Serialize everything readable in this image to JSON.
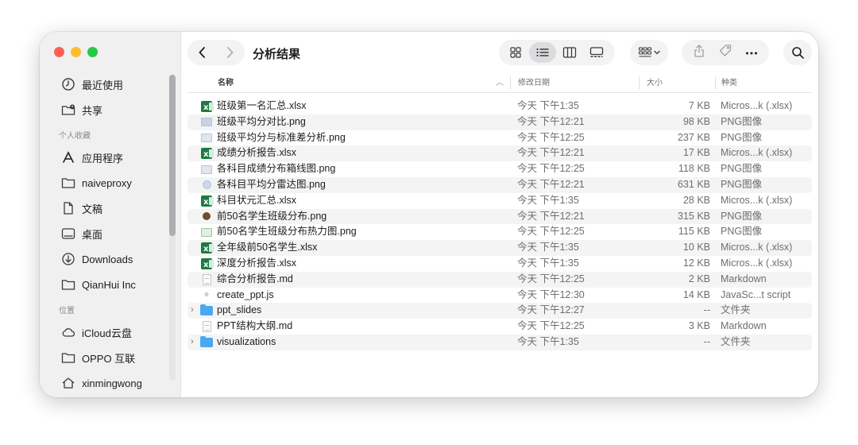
{
  "window": {
    "title": "分析结果"
  },
  "sidebar": {
    "top_items": [
      {
        "label": "最近使用",
        "icon": "clock-icon"
      },
      {
        "label": "共享",
        "icon": "shared-folder-icon"
      }
    ],
    "favorites_title": "个人收藏",
    "favorites": [
      {
        "label": "应用程序",
        "icon": "applications-icon"
      },
      {
        "label": "naiveproxy",
        "icon": "folder-icon"
      },
      {
        "label": "文稿",
        "icon": "document-icon"
      },
      {
        "label": "桌面",
        "icon": "desktop-icon"
      },
      {
        "label": "Downloads",
        "icon": "downloads-icon"
      },
      {
        "label": "QianHui Inc",
        "icon": "folder-icon"
      }
    ],
    "locations_title": "位置",
    "locations": [
      {
        "label": "iCloud云盘",
        "icon": "cloud-icon"
      },
      {
        "label": "OPPO 互联",
        "icon": "folder-icon"
      },
      {
        "label": "xinmingwong",
        "icon": "home-icon"
      }
    ]
  },
  "toolbar": {
    "back": "back-icon",
    "forward": "forward-icon",
    "views": [
      "grid-view-icon",
      "list-view-icon",
      "column-view-icon",
      "gallery-view-icon"
    ],
    "active_view": "list-view-icon",
    "group": "group-icon",
    "actions": [
      "share-icon",
      "tag-icon",
      "more-icon"
    ],
    "search": "search-icon"
  },
  "columns": {
    "name": "名称",
    "date": "修改日期",
    "size": "大小",
    "kind": "种类"
  },
  "files": [
    {
      "name": "班级第一名汇总.xlsx",
      "date": "今天 下午1:35",
      "size": "7 KB",
      "kind": "Micros...k (.xlsx)",
      "type": "xlsx"
    },
    {
      "name": "班级平均分对比.png",
      "date": "今天 下午12:21",
      "size": "98 KB",
      "kind": "PNG图像",
      "type": "png-dark"
    },
    {
      "name": "班级平均分与标准差分析.png",
      "date": "今天 下午12:25",
      "size": "237 KB",
      "kind": "PNG图像",
      "type": "png"
    },
    {
      "name": "成绩分析报告.xlsx",
      "date": "今天 下午12:21",
      "size": "17 KB",
      "kind": "Micros...k (.xlsx)",
      "type": "xlsx"
    },
    {
      "name": "各科目成绩分布箱线图.png",
      "date": "今天 下午12:25",
      "size": "118 KB",
      "kind": "PNG图像",
      "type": "png"
    },
    {
      "name": "各科目平均分雷达图.png",
      "date": "今天 下午12:21",
      "size": "631 KB",
      "kind": "PNG图像",
      "type": "png-round"
    },
    {
      "name": "科目状元汇总.xlsx",
      "date": "今天 下午1:35",
      "size": "28 KB",
      "kind": "Micros...k (.xlsx)",
      "type": "xlsx"
    },
    {
      "name": "前50名学生班级分布.png",
      "date": "今天 下午12:21",
      "size": "315 KB",
      "kind": "PNG图像",
      "type": "png-brown"
    },
    {
      "name": "前50名学生班级分布热力图.png",
      "date": "今天 下午12:25",
      "size": "115 KB",
      "kind": "PNG图像",
      "type": "png-green"
    },
    {
      "name": "全年级前50名学生.xlsx",
      "date": "今天 下午1:35",
      "size": "10 KB",
      "kind": "Micros...k (.xlsx)",
      "type": "xlsx"
    },
    {
      "name": "深度分析报告.xlsx",
      "date": "今天 下午1:35",
      "size": "12 KB",
      "kind": "Micros...k (.xlsx)",
      "type": "xlsx"
    },
    {
      "name": "综合分析报告.md",
      "date": "今天 下午12:25",
      "size": "2 KB",
      "kind": "Markdown",
      "type": "doc"
    },
    {
      "name": "create_ppt.js",
      "date": "今天 下午12:30",
      "size": "14 KB",
      "kind": "JavaSc...t script",
      "type": "js"
    },
    {
      "name": "ppt_slides",
      "date": "今天 下午12:27",
      "size": "--",
      "kind": "文件夹",
      "type": "folder"
    },
    {
      "name": "PPT结构大纲.md",
      "date": "今天 下午12:25",
      "size": "3 KB",
      "kind": "Markdown",
      "type": "doc"
    },
    {
      "name": "visualizations",
      "date": "今天 下午1:35",
      "size": "--",
      "kind": "文件夹",
      "type": "folder"
    }
  ]
}
